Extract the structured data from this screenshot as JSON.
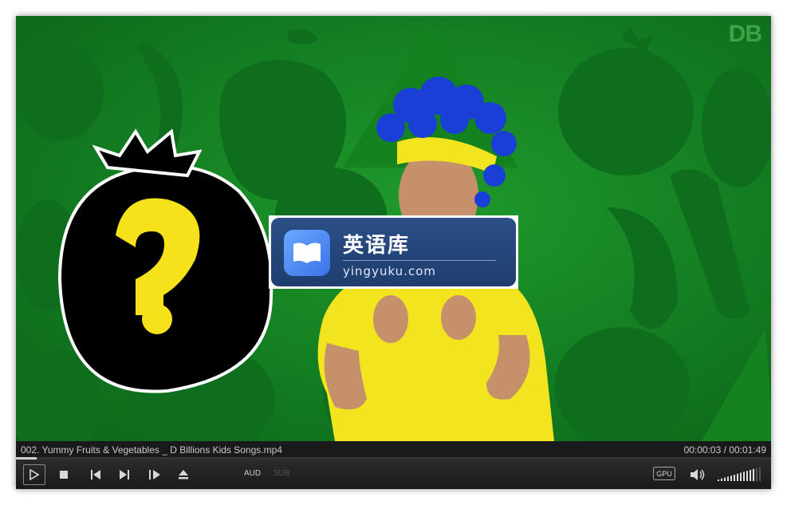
{
  "video": {
    "watermark": "DB",
    "overlay": {
      "title": "英语库",
      "subtitle": "yingyuku.com",
      "logo_icon": "open-book-icon"
    }
  },
  "info_bar": {
    "filename": "002. Yummy Fruits & Vegetables _ D Billions Kids Songs.mp4",
    "time": "00:00:03 / 00:01:49"
  },
  "playback": {
    "progress_fraction": 0.027
  },
  "controls": {
    "play_icon": "play-icon",
    "stop_icon": "stop-icon",
    "prev_icon": "skip-previous-icon",
    "next_icon": "skip-next-icon",
    "frame_icon": "frame-step-icon",
    "eject_icon": "eject-icon",
    "audio_label": "AUD",
    "subtitle_label": "SUB",
    "gpu_label": "GPU",
    "volume_icon": "speaker-icon",
    "volume_level": 0.8
  },
  "colors": {
    "background_green": "#137d22",
    "shape_green": "#0f6a1c",
    "shirt_yellow": "#f2e41f",
    "wig_blue": "#1a3fd6",
    "overlay_blue": "#2a4f86"
  }
}
